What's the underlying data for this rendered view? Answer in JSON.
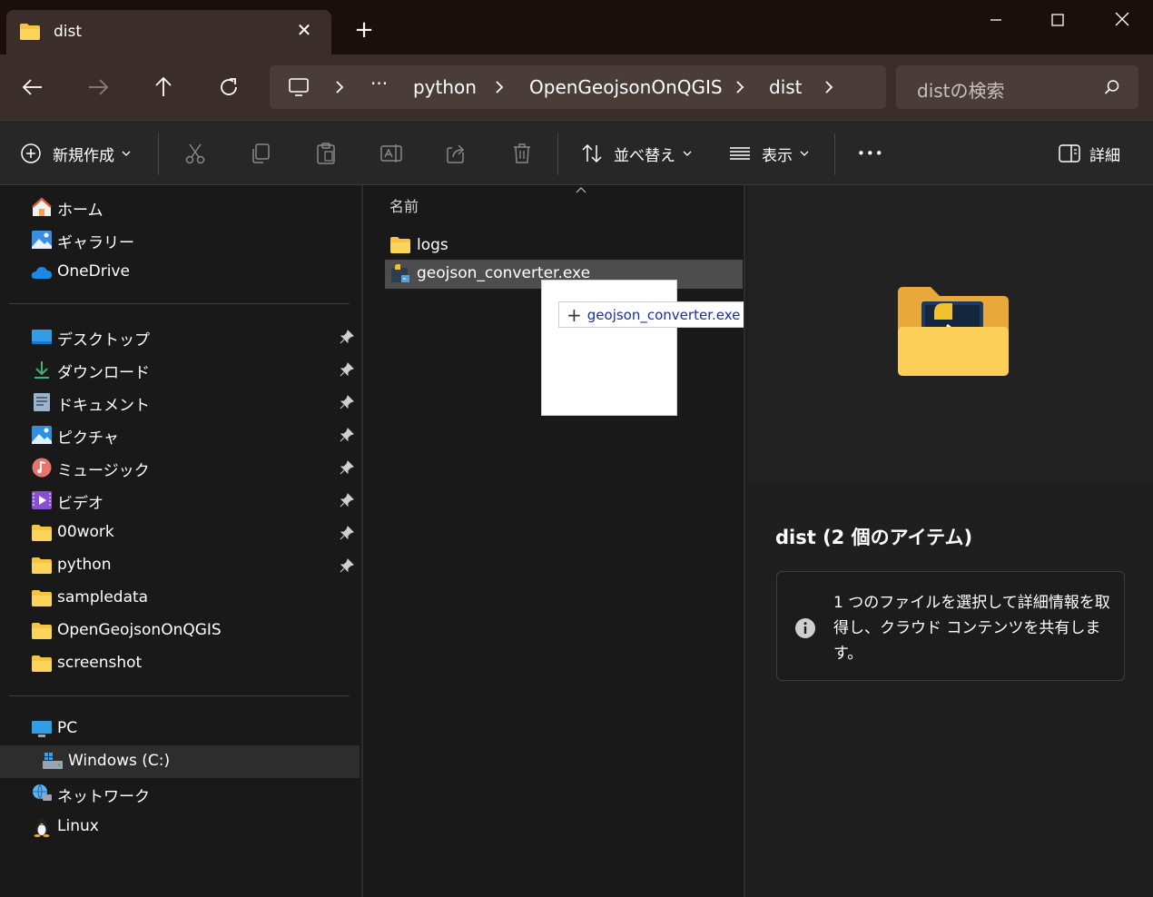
{
  "tab": {
    "title": "dist",
    "close_symbol": "✕",
    "new_tab_symbol": "+"
  },
  "window_controls": [
    "minimize",
    "maximize",
    "close"
  ],
  "breadcrumb": {
    "overflow": "···",
    "items": [
      "python",
      "OpenGeojsonOnQGIS",
      "dist"
    ]
  },
  "search": {
    "placeholder": "distの検索"
  },
  "toolbar": {
    "new_label": "新規作成",
    "sort_label": "並べ替え",
    "view_label": "表示",
    "more_label": "•••",
    "details_label": "詳細"
  },
  "sidebar": {
    "top": [
      {
        "label": "ホーム",
        "icon": "home-icon"
      },
      {
        "label": "ギャラリー",
        "icon": "gallery-icon"
      },
      {
        "label": "OneDrive",
        "icon": "onedrive-icon"
      }
    ],
    "quick": [
      {
        "label": "デスクトップ",
        "icon": "desktop-icon",
        "pinned": true
      },
      {
        "label": "ダウンロード",
        "icon": "download-icon",
        "pinned": true
      },
      {
        "label": "ドキュメント",
        "icon": "documents-icon",
        "pinned": true
      },
      {
        "label": "ピクチャ",
        "icon": "pictures-icon",
        "pinned": true
      },
      {
        "label": "ミュージック",
        "icon": "music-icon",
        "pinned": true
      },
      {
        "label": "ビデオ",
        "icon": "video-icon",
        "pinned": true
      },
      {
        "label": "00work",
        "icon": "folder-icon",
        "pinned": true
      },
      {
        "label": "python",
        "icon": "folder-icon",
        "pinned": true
      },
      {
        "label": "sampledata",
        "icon": "folder-icon",
        "pinned": false
      },
      {
        "label": "OpenGeojsonOnQGIS",
        "icon": "folder-icon",
        "pinned": false
      },
      {
        "label": "screenshot",
        "icon": "folder-icon",
        "pinned": false
      }
    ],
    "devices": [
      {
        "label": "PC",
        "icon": "pc-icon"
      },
      {
        "label": "Windows (C:)",
        "icon": "drive-icon",
        "selected": true
      },
      {
        "label": "ネットワーク",
        "icon": "network-icon"
      },
      {
        "label": "Linux",
        "icon": "linux-icon"
      }
    ]
  },
  "filelist": {
    "column_name": "名前",
    "files": [
      {
        "name": "logs",
        "icon": "folder-icon"
      },
      {
        "name": "geojson_converter.exe",
        "icon": "exe-icon",
        "selected": true
      }
    ]
  },
  "drag_tip": {
    "plus": "+",
    "text": "geojson_converter.exe で開く"
  },
  "details": {
    "title": "dist (2 個のアイテム)",
    "info": "1 つのファイルを選択して詳細情報を取得し、クラウド コンテンツを共有します。"
  },
  "colors": {
    "title_bg": "#1b0f0b",
    "nav_bg": "#3b2d2a",
    "folder": "#f6c342",
    "accent_blue": "#1a2ea0"
  }
}
